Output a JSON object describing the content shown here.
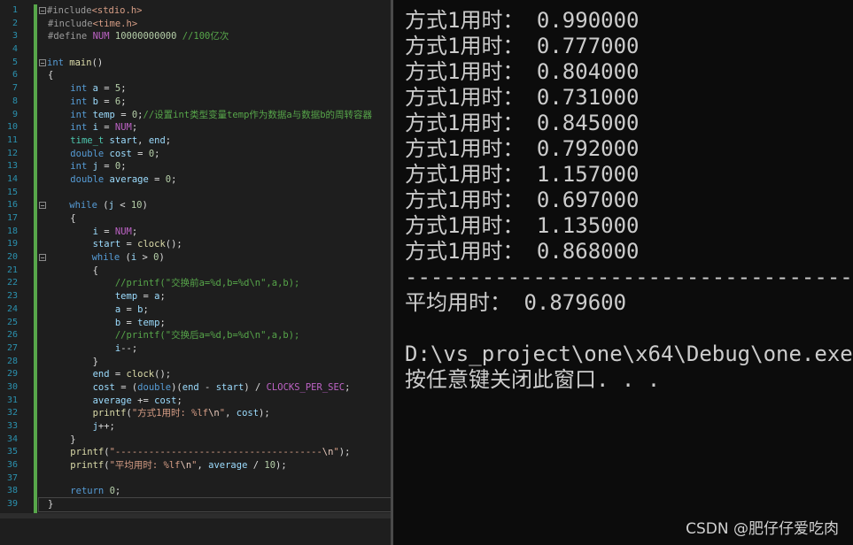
{
  "editor": {
    "current_line": 39,
    "lines": [
      {
        "n": "1",
        "indent": 0,
        "fold": "minus",
        "tokens": [
          {
            "t": "#include",
            "c": "pp"
          },
          {
            "t": "<stdio.h>",
            "c": "str"
          }
        ]
      },
      {
        "n": "2",
        "indent": 0,
        "fold": "bar",
        "tokens": [
          {
            "t": "#include",
            "c": "pp"
          },
          {
            "t": "<time.h>",
            "c": "str"
          }
        ]
      },
      {
        "n": "3",
        "indent": 0,
        "fold": "",
        "tokens": [
          {
            "t": "#define ",
            "c": "pp"
          },
          {
            "t": "NUM",
            "c": "mac"
          },
          {
            "t": " 10000000000 ",
            "c": "num"
          },
          {
            "t": "//100亿次",
            "c": "cm"
          }
        ]
      },
      {
        "n": "4",
        "indent": 0,
        "fold": "",
        "tokens": []
      },
      {
        "n": "5",
        "indent": 0,
        "fold": "minus",
        "tokens": [
          {
            "t": "int",
            "c": "kw"
          },
          {
            "t": " main",
            "c": "fn"
          },
          {
            "t": "()",
            "c": ""
          }
        ]
      },
      {
        "n": "6",
        "indent": 0,
        "fold": "",
        "tokens": [
          {
            "t": "{",
            "c": ""
          }
        ]
      },
      {
        "n": "7",
        "indent": 1,
        "fold": "",
        "tokens": [
          {
            "t": "int",
            "c": "kw"
          },
          {
            "t": " a",
            "c": "var"
          },
          {
            "t": " = ",
            "c": ""
          },
          {
            "t": "5",
            "c": "num"
          },
          {
            "t": ";",
            "c": ""
          }
        ]
      },
      {
        "n": "8",
        "indent": 1,
        "fold": "",
        "tokens": [
          {
            "t": "int",
            "c": "kw"
          },
          {
            "t": " b",
            "c": "var"
          },
          {
            "t": " = ",
            "c": ""
          },
          {
            "t": "6",
            "c": "num"
          },
          {
            "t": ";",
            "c": ""
          }
        ]
      },
      {
        "n": "9",
        "indent": 1,
        "fold": "",
        "tokens": [
          {
            "t": "int",
            "c": "kw"
          },
          {
            "t": " temp",
            "c": "var"
          },
          {
            "t": " = ",
            "c": ""
          },
          {
            "t": "0",
            "c": "num"
          },
          {
            "t": ";",
            "c": ""
          },
          {
            "t": "//设置int类型变量temp作为数据a与数据b的周转容器",
            "c": "cm"
          }
        ]
      },
      {
        "n": "10",
        "indent": 1,
        "fold": "",
        "tokens": [
          {
            "t": "int",
            "c": "kw"
          },
          {
            "t": " i",
            "c": "var"
          },
          {
            "t": " = ",
            "c": ""
          },
          {
            "t": "NUM",
            "c": "mac"
          },
          {
            "t": ";",
            "c": ""
          }
        ]
      },
      {
        "n": "11",
        "indent": 1,
        "fold": "",
        "tokens": [
          {
            "t": "time_t",
            "c": "ty"
          },
          {
            "t": " start",
            "c": "var"
          },
          {
            "t": ", ",
            "c": ""
          },
          {
            "t": "end",
            "c": "var"
          },
          {
            "t": ";",
            "c": ""
          }
        ]
      },
      {
        "n": "12",
        "indent": 1,
        "fold": "",
        "tokens": [
          {
            "t": "double",
            "c": "kw"
          },
          {
            "t": " cost",
            "c": "var"
          },
          {
            "t": " = ",
            "c": ""
          },
          {
            "t": "0",
            "c": "num"
          },
          {
            "t": ";",
            "c": ""
          }
        ]
      },
      {
        "n": "13",
        "indent": 1,
        "fold": "",
        "tokens": [
          {
            "t": "int",
            "c": "kw"
          },
          {
            "t": " j",
            "c": "var"
          },
          {
            "t": " = ",
            "c": ""
          },
          {
            "t": "0",
            "c": "num"
          },
          {
            "t": ";",
            "c": ""
          }
        ]
      },
      {
        "n": "14",
        "indent": 1,
        "fold": "",
        "tokens": [
          {
            "t": "double",
            "c": "kw"
          },
          {
            "t": " average",
            "c": "var"
          },
          {
            "t": " = ",
            "c": ""
          },
          {
            "t": "0",
            "c": "num"
          },
          {
            "t": ";",
            "c": ""
          }
        ]
      },
      {
        "n": "15",
        "indent": 1,
        "fold": "",
        "tokens": []
      },
      {
        "n": "16",
        "indent": 1,
        "fold": "minus",
        "tokens": [
          {
            "t": "while",
            "c": "kw"
          },
          {
            "t": " (",
            "c": ""
          },
          {
            "t": "j",
            "c": "var"
          },
          {
            "t": " < ",
            "c": ""
          },
          {
            "t": "10",
            "c": "num"
          },
          {
            "t": ")",
            "c": ""
          }
        ]
      },
      {
        "n": "17",
        "indent": 1,
        "fold": "",
        "tokens": [
          {
            "t": "{",
            "c": ""
          }
        ]
      },
      {
        "n": "18",
        "indent": 2,
        "fold": "",
        "tokens": [
          {
            "t": "i",
            "c": "var"
          },
          {
            "t": " = ",
            "c": ""
          },
          {
            "t": "NUM",
            "c": "mac"
          },
          {
            "t": ";",
            "c": ""
          }
        ]
      },
      {
        "n": "19",
        "indent": 2,
        "fold": "",
        "tokens": [
          {
            "t": "start",
            "c": "var"
          },
          {
            "t": " = ",
            "c": ""
          },
          {
            "t": "clock",
            "c": "fn"
          },
          {
            "t": "();",
            "c": ""
          }
        ]
      },
      {
        "n": "20",
        "indent": 2,
        "fold": "minus",
        "tokens": [
          {
            "t": "while",
            "c": "kw"
          },
          {
            "t": " (",
            "c": ""
          },
          {
            "t": "i",
            "c": "var"
          },
          {
            "t": " > ",
            "c": ""
          },
          {
            "t": "0",
            "c": "num"
          },
          {
            "t": ")",
            "c": ""
          }
        ]
      },
      {
        "n": "21",
        "indent": 2,
        "fold": "",
        "tokens": [
          {
            "t": "{",
            "c": ""
          }
        ]
      },
      {
        "n": "22",
        "indent": 3,
        "fold": "",
        "tokens": [
          {
            "t": "//printf(\"交换前a=%d,b=%d\\n\",a,b);",
            "c": "cm"
          }
        ]
      },
      {
        "n": "23",
        "indent": 3,
        "fold": "",
        "tokens": [
          {
            "t": "temp",
            "c": "var"
          },
          {
            "t": " = ",
            "c": ""
          },
          {
            "t": "a",
            "c": "var"
          },
          {
            "t": ";",
            "c": ""
          }
        ]
      },
      {
        "n": "24",
        "indent": 3,
        "fold": "",
        "tokens": [
          {
            "t": "a",
            "c": "var"
          },
          {
            "t": " = ",
            "c": ""
          },
          {
            "t": "b",
            "c": "var"
          },
          {
            "t": ";",
            "c": ""
          }
        ]
      },
      {
        "n": "25",
        "indent": 3,
        "fold": "",
        "tokens": [
          {
            "t": "b",
            "c": "var"
          },
          {
            "t": " = ",
            "c": ""
          },
          {
            "t": "temp",
            "c": "var"
          },
          {
            "t": ";",
            "c": ""
          }
        ]
      },
      {
        "n": "26",
        "indent": 3,
        "fold": "",
        "tokens": [
          {
            "t": "//printf(\"交换后a=%d,b=%d\\n\",a,b);",
            "c": "cm"
          }
        ]
      },
      {
        "n": "27",
        "indent": 3,
        "fold": "",
        "tokens": [
          {
            "t": "i",
            "c": "var"
          },
          {
            "t": "--;",
            "c": ""
          }
        ]
      },
      {
        "n": "28",
        "indent": 2,
        "fold": "",
        "tokens": [
          {
            "t": "}",
            "c": ""
          }
        ]
      },
      {
        "n": "29",
        "indent": 2,
        "fold": "",
        "tokens": [
          {
            "t": "end",
            "c": "var"
          },
          {
            "t": " = ",
            "c": ""
          },
          {
            "t": "clock",
            "c": "fn"
          },
          {
            "t": "();",
            "c": ""
          }
        ]
      },
      {
        "n": "30",
        "indent": 2,
        "fold": "",
        "tokens": [
          {
            "t": "cost",
            "c": "var"
          },
          {
            "t": " = (",
            "c": ""
          },
          {
            "t": "double",
            "c": "kw"
          },
          {
            "t": ")(",
            "c": ""
          },
          {
            "t": "end",
            "c": "var"
          },
          {
            "t": " - ",
            "c": ""
          },
          {
            "t": "start",
            "c": "var"
          },
          {
            "t": ") / ",
            "c": ""
          },
          {
            "t": "CLOCKS_PER_SEC",
            "c": "mac"
          },
          {
            "t": ";",
            "c": ""
          }
        ]
      },
      {
        "n": "31",
        "indent": 2,
        "fold": "",
        "tokens": [
          {
            "t": "average",
            "c": "var"
          },
          {
            "t": " += ",
            "c": ""
          },
          {
            "t": "cost",
            "c": "var"
          },
          {
            "t": ";",
            "c": ""
          }
        ]
      },
      {
        "n": "32",
        "indent": 2,
        "fold": "",
        "tokens": [
          {
            "t": "printf",
            "c": "fn"
          },
          {
            "t": "(",
            "c": ""
          },
          {
            "t": "\"方式1用时: %lf",
            "c": "str"
          },
          {
            "t": "\\n",
            "c": "esc"
          },
          {
            "t": "\"",
            "c": "str"
          },
          {
            "t": ", ",
            "c": ""
          },
          {
            "t": "cost",
            "c": "var"
          },
          {
            "t": ");",
            "c": ""
          }
        ]
      },
      {
        "n": "33",
        "indent": 2,
        "fold": "",
        "tokens": [
          {
            "t": "j",
            "c": "var"
          },
          {
            "t": "++;",
            "c": ""
          }
        ]
      },
      {
        "n": "34",
        "indent": 1,
        "fold": "",
        "tokens": [
          {
            "t": "}",
            "c": ""
          }
        ]
      },
      {
        "n": "35",
        "indent": 1,
        "fold": "",
        "tokens": [
          {
            "t": "printf",
            "c": "fn"
          },
          {
            "t": "(",
            "c": ""
          },
          {
            "t": "\"-------------------------------------",
            "c": "str"
          },
          {
            "t": "\\n",
            "c": "esc"
          },
          {
            "t": "\"",
            "c": "str"
          },
          {
            "t": ");",
            "c": ""
          }
        ]
      },
      {
        "n": "36",
        "indent": 1,
        "fold": "",
        "tokens": [
          {
            "t": "printf",
            "c": "fn"
          },
          {
            "t": "(",
            "c": ""
          },
          {
            "t": "\"平均用时: %lf",
            "c": "str"
          },
          {
            "t": "\\n",
            "c": "esc"
          },
          {
            "t": "\"",
            "c": "str"
          },
          {
            "t": ", ",
            "c": ""
          },
          {
            "t": "average",
            "c": "var"
          },
          {
            "t": " / ",
            "c": ""
          },
          {
            "t": "10",
            "c": "num"
          },
          {
            "t": ");",
            "c": ""
          }
        ]
      },
      {
        "n": "37",
        "indent": 1,
        "fold": "",
        "tokens": []
      },
      {
        "n": "38",
        "indent": 1,
        "fold": "",
        "tokens": [
          {
            "t": "return",
            "c": "kw"
          },
          {
            "t": " ",
            "c": ""
          },
          {
            "t": "0",
            "c": "num"
          },
          {
            "t": ";",
            "c": ""
          }
        ]
      },
      {
        "n": "39",
        "indent": 0,
        "fold": "",
        "tokens": [
          {
            "t": "}",
            "c": ""
          }
        ]
      }
    ]
  },
  "console": {
    "lines": [
      "方式1用时： 0.990000",
      "方式1用时： 0.777000",
      "方式1用时： 0.804000",
      "方式1用时： 0.731000",
      "方式1用时： 0.845000",
      "方式1用时： 0.792000",
      "方式1用时： 1.157000",
      "方式1用时： 0.697000",
      "方式1用时： 1.135000",
      "方式1用时： 0.868000",
      "-----------------------------------------",
      "平均用时： 0.879600",
      "",
      "D:\\vs_project\\one\\x64\\Debug\\one.exe",
      "按任意键关闭此窗口. . ."
    ]
  },
  "watermark": "CSDN @肥仔仔爱吃肉"
}
